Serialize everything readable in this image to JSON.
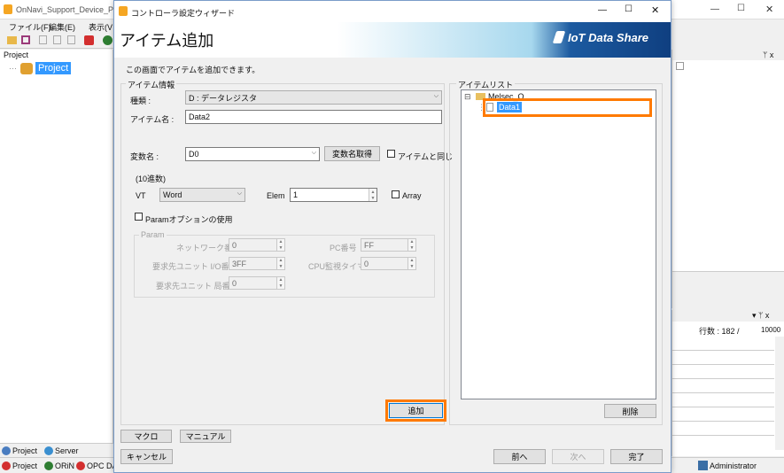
{
  "bg_app": {
    "title": "OnNavi_Support_Device_PLC",
    "menu": [
      "ファイル(F)",
      "編集(E)",
      "表示(V"
    ],
    "project_panel_title": "Project",
    "tree_root": "Project",
    "bottom_tabs": [
      "Project",
      "Server"
    ],
    "status": [
      "Project",
      "ORiN",
      "OPC DA"
    ],
    "right_rows_label": "行数 : 182 /",
    "right_rows_value": "10000",
    "user": "Administrator",
    "pin": "ᛘ x"
  },
  "dialog": {
    "title": "コントローラ設定ウィザード",
    "heading": "アイテム追加",
    "brand": "IoT Data Share",
    "description": "この画面でアイテムを追加できます。",
    "item_info": {
      "group_label": "アイテム情報",
      "kind_label": "種類 :",
      "kind_value": "D : データレジスタ",
      "name_label": "アイテム名 :",
      "name_value": "Data2",
      "var_label": "変数名 :",
      "var_value": "D0",
      "get_var_button": "変数名取得",
      "same_as_item": "アイテムと同じ",
      "radix": "(10進数)",
      "vt_label": "VT",
      "vt_value": "Word",
      "elem_label": "Elem",
      "elem_value": "1",
      "array_label": "Array",
      "param_option": "Paramオプションの使用",
      "param_group": "Param",
      "network_label": "ネットワーク番号",
      "network_value": "0",
      "pc_label": "PC番号",
      "pc_value": "FF",
      "io_label": "要求先ユニット I/O番号",
      "io_value": "3FF",
      "cpu_timer_label": "CPU監視タイマ",
      "cpu_timer_value": "0",
      "station_label": "要求先ユニット 局番号",
      "station_value": "0",
      "add_button": "追加"
    },
    "item_list": {
      "group_label": "アイテムリスト",
      "root": "Melsec_Q",
      "child": "Data1",
      "delete_button": "削除"
    },
    "buttons": {
      "macro": "マクロ",
      "manual": "マニュアル",
      "cancel": "キャンセル",
      "prev": "前へ",
      "next": "次へ",
      "finish": "完了"
    }
  },
  "colors": {
    "accent": "#1c5aa0",
    "highlight": "#ff7a00",
    "selection": "#3399ff"
  }
}
